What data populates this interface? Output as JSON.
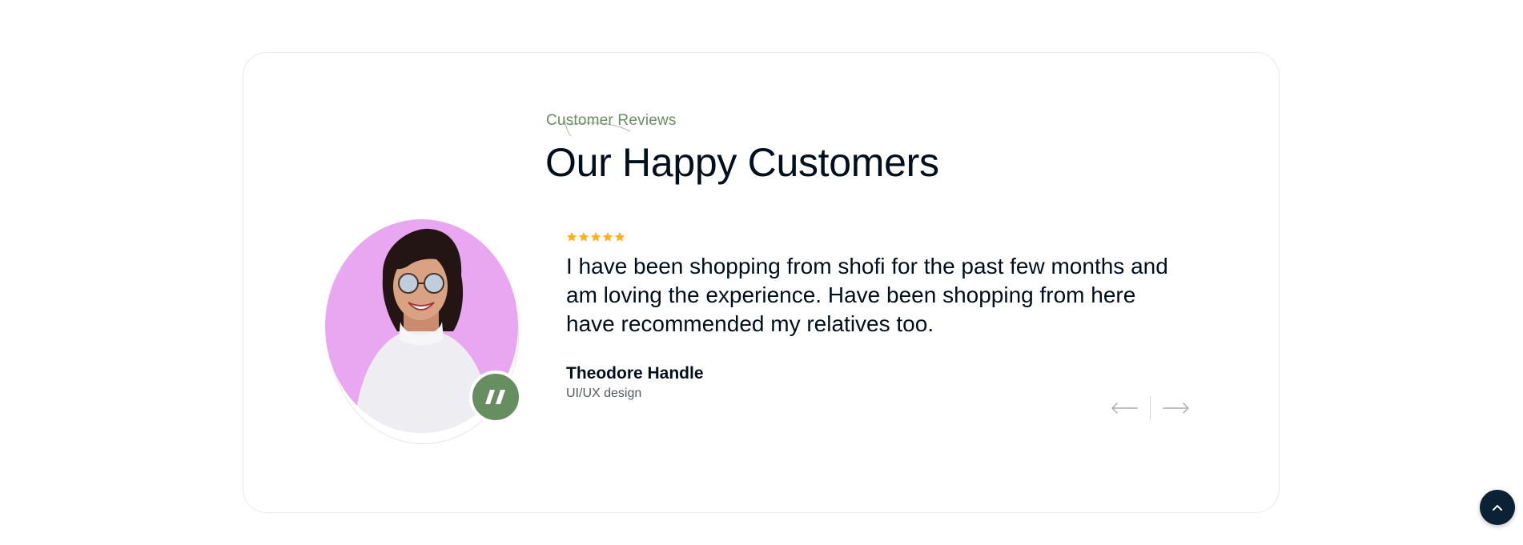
{
  "section": {
    "subtitle": "Customer Reviews",
    "title": "Our Happy Customers"
  },
  "testimonial": {
    "rating": 5,
    "rating_max": 5,
    "text": "I have been shopping from shofi for the past few months and am loving the experience. Have been shopping from here have recommended my relatives too.",
    "author_name": "Theodore Handle",
    "author_role": "UI/UX design",
    "photo_bg": "#e9a6f1"
  },
  "navigation": {
    "prev_icon": "arrow-left-icon",
    "next_icon": "arrow-right-icon"
  },
  "scroll_top": {
    "icon": "chevron-up-icon"
  },
  "colors": {
    "accent_green": "#678e61",
    "star": "#ffb21d",
    "dark": "#010f1c",
    "scroll_btn": "#0b2134"
  }
}
